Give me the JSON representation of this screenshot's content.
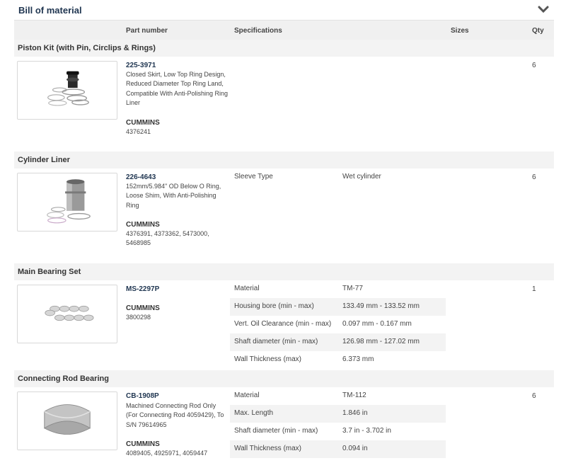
{
  "header": {
    "title": "Bill of material",
    "collapse_icon": "chevron-down-icon"
  },
  "columns": {
    "part_number": "Part number",
    "specifications": "Specifications",
    "sizes": "Sizes",
    "qty": "Qty"
  },
  "sections": [
    {
      "title": "Piston Kit (with Pin, Circlips & Rings)",
      "part_number": "225-3971",
      "description": "Closed Skirt, Low Top Ring Design, Reduced Diameter Top Ring Land, Compatible With Anti-Polishing Ring Liner",
      "brand": "CUMMINS",
      "oem": "4376241",
      "specs": [],
      "qty": "6"
    },
    {
      "title": "Cylinder Liner",
      "part_number": "226-4643",
      "description": "152mm/5.984\" OD Below O Ring, Loose Shim, With Anti-Polishing Ring",
      "brand": "CUMMINS",
      "oem": "4376391, 4373362, 5473000, 5468985",
      "specs": [
        {
          "label": "Sleeve Type",
          "value": "Wet cylinder"
        }
      ],
      "qty": "6"
    },
    {
      "title": "Main Bearing Set",
      "part_number": "MS-2297P",
      "description": "",
      "brand": "CUMMINS",
      "oem": "3800298",
      "specs": [
        {
          "label": "Material",
          "value": "TM-77"
        },
        {
          "label": "Housing bore (min - max)",
          "value": "133.49 mm - 133.52 mm"
        },
        {
          "label": "Vert. Oil Clearance (min - max)",
          "value": "0.097 mm - 0.167 mm"
        },
        {
          "label": "Shaft diameter (min - max)",
          "value": "126.98 mm - 127.02 mm"
        },
        {
          "label": "Wall Thickness (max)",
          "value": "6.373 mm"
        }
      ],
      "qty": "1"
    },
    {
      "title": "Connecting Rod Bearing",
      "part_number": "CB-1908P",
      "description": "Machined Connecting Rod Only (For Connecting Rod 4059429), To S/N 79614965",
      "brand": "CUMMINS",
      "oem": "4089405, 4925971, 4059447",
      "specs": [
        {
          "label": "Material",
          "value": "TM-112"
        },
        {
          "label": "Max. Length",
          "value": "1.846 in"
        },
        {
          "label": "Shaft diameter (min - max)",
          "value": "3.7 in - 3.702 in"
        },
        {
          "label": "Wall Thickness (max)",
          "value": "0.094 in"
        }
      ],
      "qty": "6"
    }
  ]
}
